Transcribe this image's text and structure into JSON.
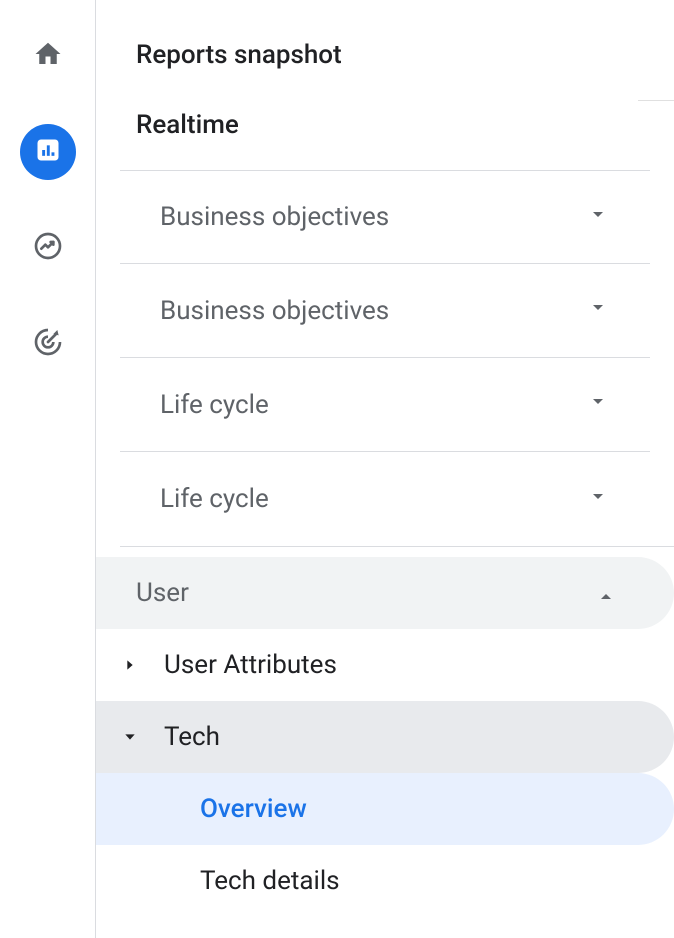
{
  "top": {
    "reports_snapshot": "Reports snapshot",
    "realtime": "Realtime"
  },
  "sections": {
    "business_objectives_1": "Business objectives",
    "business_objectives_2": "Business objectives",
    "life_cycle_1": "Life cycle",
    "life_cycle_2": "Life cycle",
    "user": "User"
  },
  "user_section": {
    "user_attributes": "User Attributes",
    "tech": "Tech",
    "tech_children": {
      "overview": "Overview",
      "tech_details": "Tech details"
    }
  },
  "rail_icons": {
    "home": "home-icon",
    "reports": "chart-icon",
    "explore": "trend-icon",
    "advertising": "target-icon"
  }
}
